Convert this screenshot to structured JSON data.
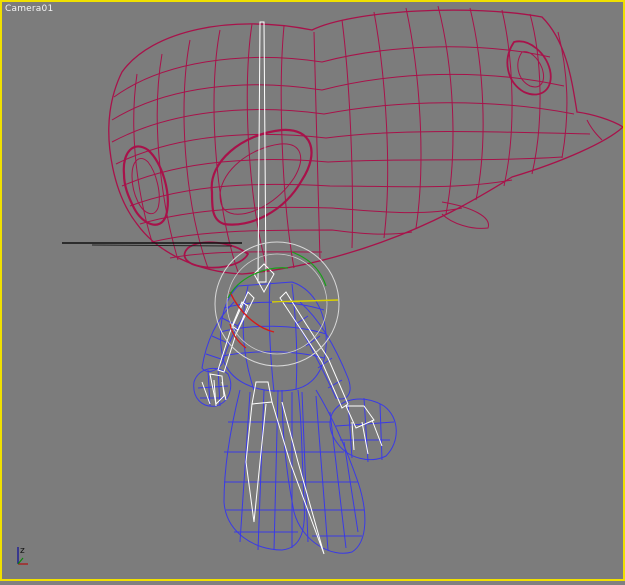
{
  "viewport": {
    "label": "Camera01",
    "active_border_color": "#f0e000",
    "background": "#7c7c7c"
  },
  "scene": {
    "objects": [
      {
        "name": "head-mesh",
        "wire_color": "#a8124a"
      },
      {
        "name": "body-mesh",
        "wire_color": "#3a3ae6"
      },
      {
        "name": "skeleton-bones",
        "wire_color": "#ffffff"
      }
    ]
  },
  "axis_gizmo": {
    "icon": "axis-tripod-icon",
    "z_label": "z"
  }
}
